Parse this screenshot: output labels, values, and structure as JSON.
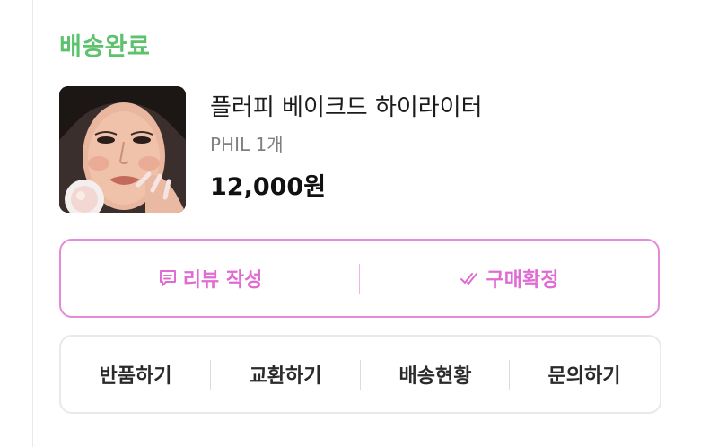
{
  "order": {
    "status": "배송완료",
    "status_color": "#5cc26b"
  },
  "product": {
    "name": "플러피 베이크드 하이라이터",
    "option": "PHIL 1개",
    "price": "12,000원",
    "image": "product-photo"
  },
  "primary_actions": {
    "review_label": "리뷰 작성",
    "review_icon": "chat-bubble-icon",
    "confirm_label": "구매확정",
    "confirm_icon": "double-check-icon",
    "accent_color": "#e06bd3"
  },
  "secondary_actions": [
    {
      "label": "반품하기"
    },
    {
      "label": "교환하기"
    },
    {
      "label": "배송현황"
    },
    {
      "label": "문의하기"
    }
  ]
}
